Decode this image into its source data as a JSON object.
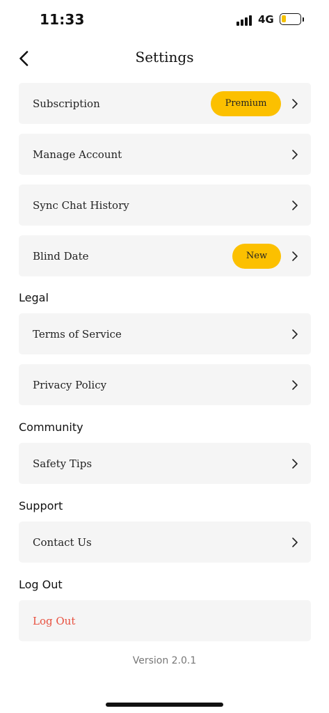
{
  "status_bar": {
    "time": "11:33",
    "network": "4G",
    "battery_level": 0.25,
    "battery_color": "#f5c100"
  },
  "nav": {
    "title": "Settings",
    "back_icon": "chevron-left-icon"
  },
  "account_items": [
    {
      "label": "Subscription",
      "badge": "Premium"
    },
    {
      "label": "Manage Account"
    },
    {
      "label": "Sync Chat History"
    },
    {
      "label": "Blind Date",
      "badge": "New"
    }
  ],
  "sections": {
    "legal": {
      "title": "Legal",
      "items": [
        {
          "label": "Terms of Service"
        },
        {
          "label": "Privacy Policy"
        }
      ]
    },
    "community": {
      "title": "Community",
      "items": [
        {
          "label": "Safety Tips"
        }
      ]
    },
    "support": {
      "title": "Support",
      "items": [
        {
          "label": "Contact Us"
        }
      ]
    },
    "logout": {
      "title": "Log Out",
      "items": [
        {
          "label": "Log Out"
        }
      ]
    }
  },
  "version": "Version 2.0.1",
  "colors": {
    "accent": "#fcc000",
    "danger": "#e8503f",
    "row_background": "#f5f5f5"
  }
}
